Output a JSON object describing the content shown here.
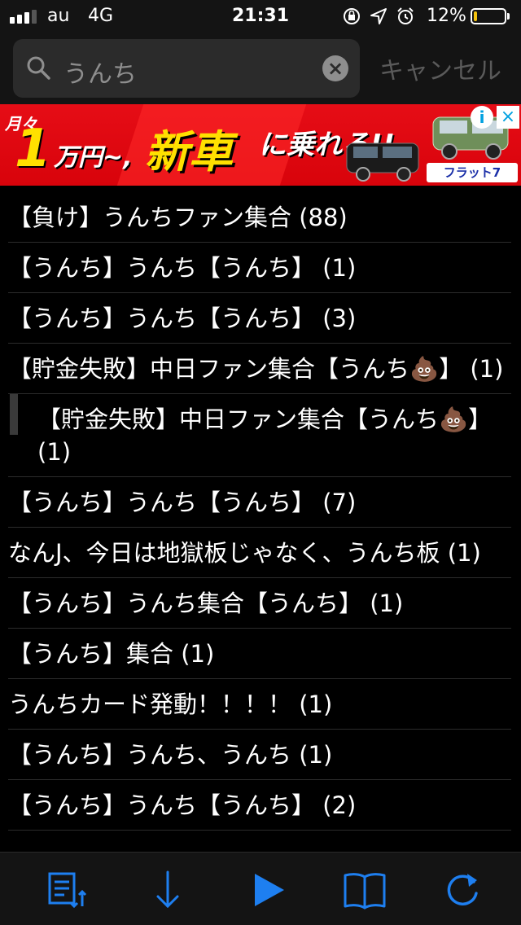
{
  "status_bar": {
    "carrier": "au",
    "network": "4G",
    "time": "21:31",
    "battery_percent": "12%",
    "battery_level": 0.12,
    "icons": [
      "orientation-lock-icon",
      "location-icon",
      "alarm-icon"
    ]
  },
  "search": {
    "query": "うんち",
    "cancel_label": "キャンセル"
  },
  "ad": {
    "subtitle": "月々",
    "price_number": "1",
    "price_unit": "万円~,",
    "headline": "新車",
    "tagline": "に乗れる!!",
    "logo": "フラット7",
    "info_label": "i",
    "close_label": "×",
    "colors": {
      "background": "#e60d16",
      "headline": "#ffe000"
    }
  },
  "results": [
    {
      "title": "【負け】うんちファン集合 (88)",
      "indented": false
    },
    {
      "title": "【うんち】うんち【うんち】 (1)",
      "indented": false
    },
    {
      "title": "【うんち】うんち【うんち】 (3)",
      "indented": false
    },
    {
      "title": "【貯金失敗】中日ファン集合【うんち💩】 (1)",
      "indented": false
    },
    {
      "title": "【貯金失敗】中日ファン集合【うんち💩】 (1)",
      "indented": true
    },
    {
      "title": "【うんち】うんち【うんち】 (7)",
      "indented": false
    },
    {
      "title": "なんJ、今日は地獄板じゃなく、うんち板 (1)",
      "indented": false
    },
    {
      "title": "【うんち】うんち集合【うんち】 (1)",
      "indented": false
    },
    {
      "title": "【うんち】集合 (1)",
      "indented": false
    },
    {
      "title": "うんちカード発動！！！！ (1)",
      "indented": false
    },
    {
      "title": "【うんち】うんち、うんち (1)",
      "indented": false
    },
    {
      "title": "【うんち】うんち【うんち】 (2)",
      "indented": false
    }
  ],
  "toolbar": {
    "icons": [
      "sort-list-icon",
      "scroll-down-icon",
      "play-icon",
      "bookmarks-icon",
      "refresh-icon"
    ],
    "accent_color": "#1e7ff0"
  }
}
